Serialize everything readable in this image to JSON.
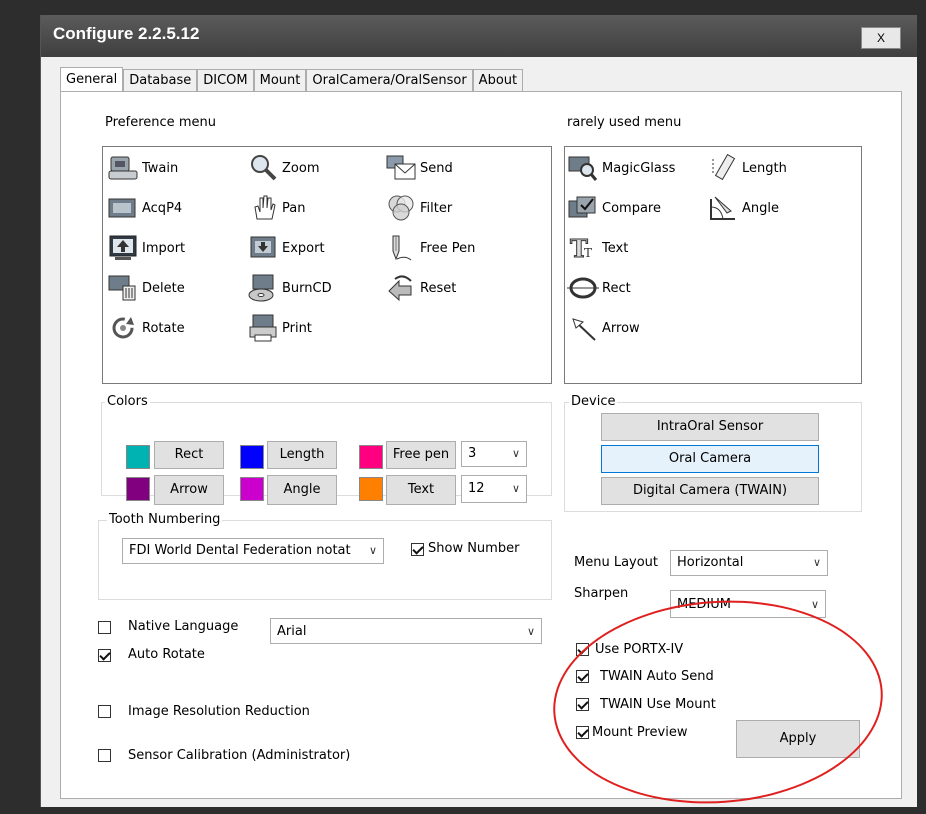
{
  "window": {
    "title": "Configure 2.2.5.12",
    "close_label": "X"
  },
  "tabs": [
    "General",
    "Database",
    "DICOM",
    "Mount",
    "OralCamera/OralSensor",
    "About"
  ],
  "preference_menu": {
    "label": "Preference menu",
    "items": [
      "Twain",
      "Zoom",
      "Send",
      "AcqP4",
      "Pan",
      "Filter",
      "Import",
      "Export",
      "Free Pen",
      "Delete",
      "BurnCD",
      "Reset",
      "Rotate",
      "Print"
    ]
  },
  "rarely_used_menu": {
    "label": "rarely used menu",
    "items": [
      "MagicGlass",
      "Length",
      "Compare",
      "Angle",
      "Text",
      "Rect",
      "Arrow"
    ]
  },
  "colors": {
    "label": "Colors",
    "items": [
      {
        "label": "Rect",
        "color": "#00b3b3"
      },
      {
        "label": "Length",
        "color": "#0000ff"
      },
      {
        "label": "Free pen",
        "color": "#ff0080"
      },
      {
        "label": "Arrow",
        "color": "#800080"
      },
      {
        "label": "Angle",
        "color": "#cc00cc"
      },
      {
        "label": "Text",
        "color": "#ff8000"
      }
    ],
    "pen_width": "3",
    "text_size": "12"
  },
  "device": {
    "label": "Device",
    "buttons": [
      "IntraOral Sensor",
      "Oral Camera",
      "Digital Camera (TWAIN)"
    ],
    "selected": "Oral Camera"
  },
  "tooth_numbering": {
    "label": "Tooth Numbering",
    "value": "FDI World Dental Federation notat",
    "show_number_label": "Show Number",
    "show_number": true
  },
  "menu_layout": {
    "label": "Menu Layout",
    "value": "Horizontal"
  },
  "sharpen": {
    "label": "Sharpen",
    "value": "MEDIUM"
  },
  "options_left": [
    {
      "label": "Native Language",
      "checked": false
    },
    {
      "label": "Auto Rotate",
      "checked": true
    },
    {
      "label": "Image Resolution Reduction",
      "checked": false
    },
    {
      "label": "Sensor Calibration (Administrator)",
      "checked": false
    }
  ],
  "font": {
    "value": "Arial"
  },
  "options_right": [
    {
      "label": "Use PORTX-IV",
      "checked": true
    },
    {
      "label": "TWAIN Auto Send",
      "checked": true
    },
    {
      "label": "TWAIN Use Mount",
      "checked": true
    },
    {
      "label": "Mount Preview",
      "checked": true
    }
  ],
  "apply_label": "Apply",
  "annotation_color": "#e0201f"
}
